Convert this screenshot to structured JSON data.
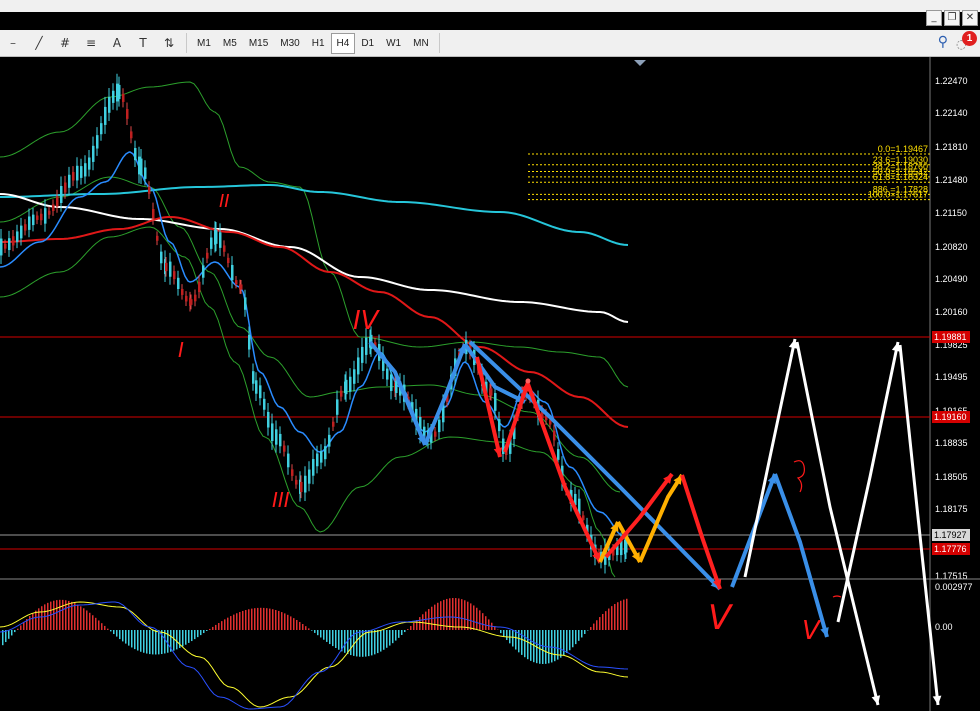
{
  "toolbar": {
    "tools": [
      {
        "name": "line-tool-icon",
        "glyph": "╱"
      },
      {
        "name": "grid-tool-icon",
        "glyph": "#"
      },
      {
        "name": "fibo-tool-icon",
        "glyph": "≡"
      },
      {
        "name": "text-tool-icon",
        "glyph": "A"
      },
      {
        "name": "label-tool-icon",
        "glyph": "T"
      },
      {
        "name": "arrows-tool-icon",
        "glyph": "⇅"
      }
    ],
    "timeframes": [
      "M1",
      "M5",
      "M15",
      "M30",
      "H1",
      "H4",
      "D1",
      "W1",
      "MN"
    ],
    "active_timeframe": "H4",
    "notification_count": "1"
  },
  "window": {
    "minimize": "_",
    "restore": "❐",
    "close": "✕"
  },
  "colors": {
    "background": "#000000",
    "price_red_line": "#d40000",
    "fib_yellow": "#ffe000",
    "ma_cyan": "#26c6da",
    "ma_white": "#ffffff",
    "ma_red": "#e01818",
    "ma_blue": "#2a8cff",
    "bollinger": "#2ca02c",
    "macd_up": "#e03030",
    "macd_down": "#40d0e0",
    "signal": "#ffff30"
  },
  "chart_data": {
    "type": "line",
    "symbol_timeframe": "H4",
    "price_axis": [
      "1.22470",
      "1.22140",
      "1.21810",
      "1.21480",
      "1.21150",
      "1.20820",
      "1.20490",
      "1.20160",
      "1.19825",
      "1.19495",
      "1.19165",
      "1.18835",
      "1.18505",
      "1.18175",
      "1.17515"
    ],
    "price_labels": {
      "upper_red": "1.19881",
      "mid_red": "1.19160",
      "current": "1.17927",
      "lower_red": "1.17776"
    },
    "fib_levels": [
      {
        "label": "0.0=1.19467",
        "value": 1.19467
      },
      {
        "label": "23.6=1.19030",
        "value": 1.1903
      },
      {
        "label": "38.2=1.18760",
        "value": 1.1876
      },
      {
        "label": "50.0=1.18542",
        "value": 1.18542
      },
      {
        "label": "61.8=1.18324",
        "value": 1.18324
      },
      {
        "label": "886.=1.17828",
        "value": 1.17828
      },
      {
        "label": "100.0=1.17617",
        "value": 1.17617
      }
    ],
    "indicator_axis": [
      "0.002977",
      "0.00"
    ],
    "wave_labels": [
      "I",
      "II",
      "III",
      "IV",
      "V",
      "V"
    ]
  }
}
